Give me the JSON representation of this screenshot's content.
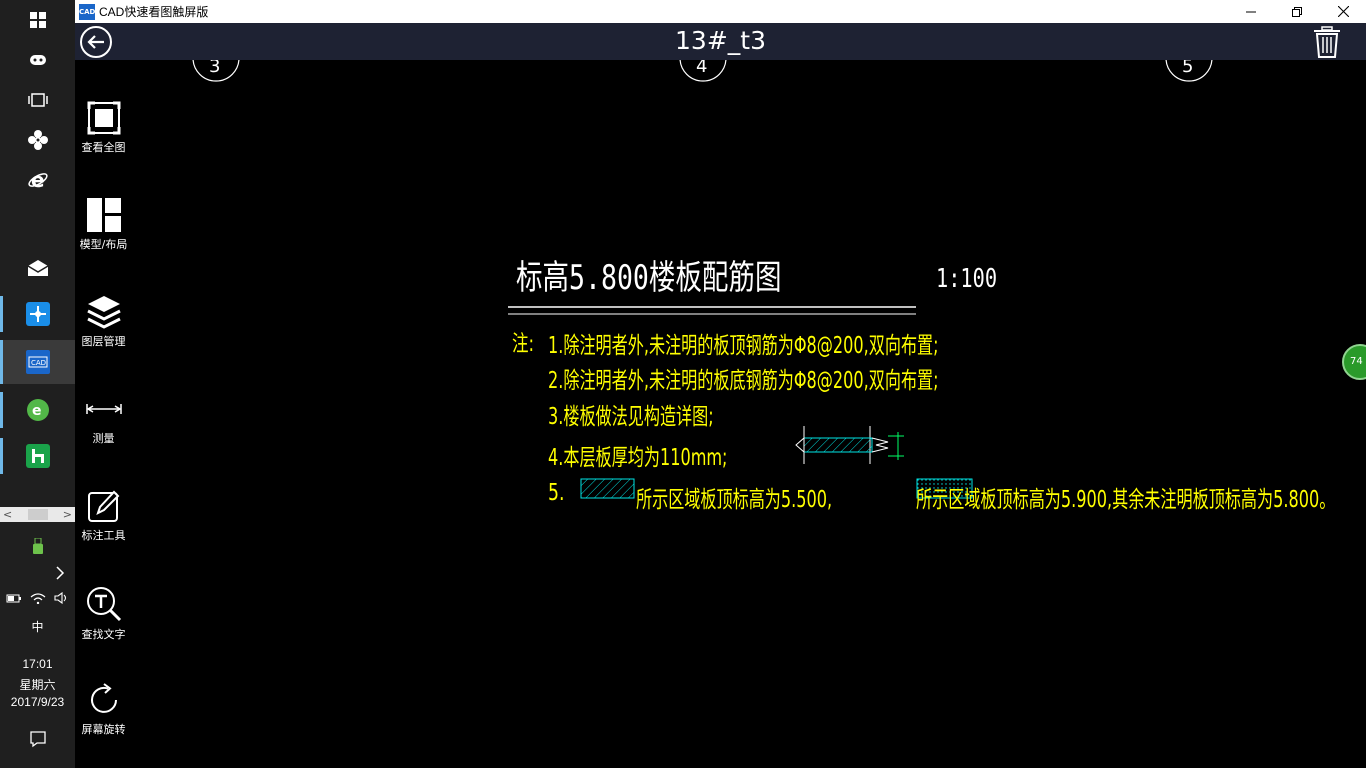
{
  "window": {
    "app_title": "CAD快速看图触屏版",
    "logo_text": "CAD"
  },
  "header": {
    "doc_title": "13#_t3"
  },
  "tools": [
    {
      "label": "查看全图",
      "icon": "view-all-icon"
    },
    {
      "label": "模型/布局",
      "icon": "layout-icon"
    },
    {
      "label": "图层管理",
      "icon": "layers-icon"
    },
    {
      "label": "测量",
      "icon": "measure-icon"
    },
    {
      "label": "标注工具",
      "icon": "annotate-icon"
    },
    {
      "label": "查找文字",
      "icon": "find-text-icon"
    },
    {
      "label": "屏幕旋转",
      "icon": "rotate-icon"
    }
  ],
  "taskbar": {
    "ime": "中",
    "time": "17:01",
    "weekday": "星期六",
    "date": "2017/9/23",
    "scroll_left": "<",
    "scroll_right": ">"
  },
  "drawing": {
    "title": "标高5.800楼板配筋图",
    "scale": "1:100",
    "note_prefix": "注:",
    "notes": [
      "1.除注明者外,未注明的板顶钢筋为Φ8@200,双向布置;",
      "2.除注明者外,未注明的板底钢筋为Φ8@200,双向布置;",
      "3.楼板做法见构造详图;",
      "4.本层板厚均为110mm;"
    ],
    "note5_number": "5.",
    "note5_part1": "所示区域板顶标高为5.500,",
    "note5_part2": "所示区域板顶标高为5.900,其余未注明板顶标高为5.800。",
    "axis_labels": [
      "3",
      "4",
      "5"
    ],
    "badge": "74"
  },
  "colors": {
    "text_yellow": "#ffff00",
    "header_bg": "#1e2233",
    "hatch_cyan": "#00e5e5",
    "dim_green": "#00ff66"
  }
}
